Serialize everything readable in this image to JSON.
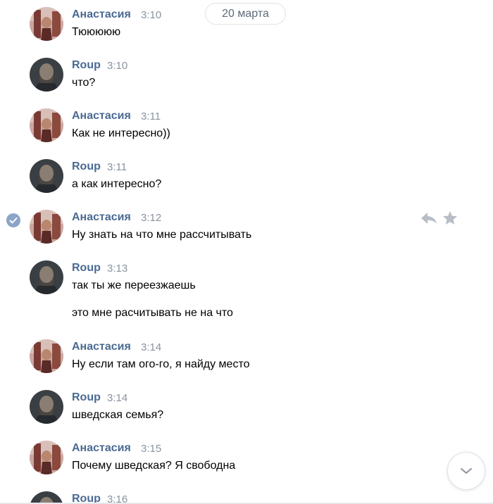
{
  "date_divider": "20 марта",
  "messages": [
    {
      "author": "Анастасия",
      "time": "3:10",
      "text": "Тююююю",
      "who": "a"
    },
    {
      "author": "Roup",
      "time": "3:10",
      "text": "что?",
      "who": "r"
    },
    {
      "author": "Анастасия",
      "time": "3:11",
      "text": "Как не интересно))",
      "who": "a"
    },
    {
      "author": "Roup",
      "time": "3:11",
      "text": "а как интересно?",
      "who": "r"
    },
    {
      "author": "Анастасия",
      "time": "3:12",
      "text": "Ну знать на что мне рассчитывать",
      "who": "a"
    },
    {
      "author": "Roup",
      "time": "3:13",
      "text": "так ты же переезжаешь",
      "text2": "это мне расчитывать не на что",
      "who": "r"
    },
    {
      "author": "Анастасия",
      "time": "3:14",
      "text": "Ну если там ого-го, я найду место",
      "who": "a"
    },
    {
      "author": "Roup",
      "time": "3:14",
      "text": "шведская семья?",
      "who": "r"
    },
    {
      "author": "Анастасия",
      "time": "3:15",
      "text": "Почему шведская? Я свободна",
      "who": "a"
    },
    {
      "author": "Roup",
      "time": "3:16",
      "text": "",
      "who": "r"
    }
  ],
  "icons": {
    "selected_check": "check-circle-icon",
    "reply": "reply-icon",
    "favorite": "star-icon",
    "scroll_down": "chevron-down-icon"
  },
  "colors": {
    "author": "#4a6a92",
    "time": "#8a939e",
    "check": "#8aa5c8",
    "action_icons": "#b8bec6"
  }
}
